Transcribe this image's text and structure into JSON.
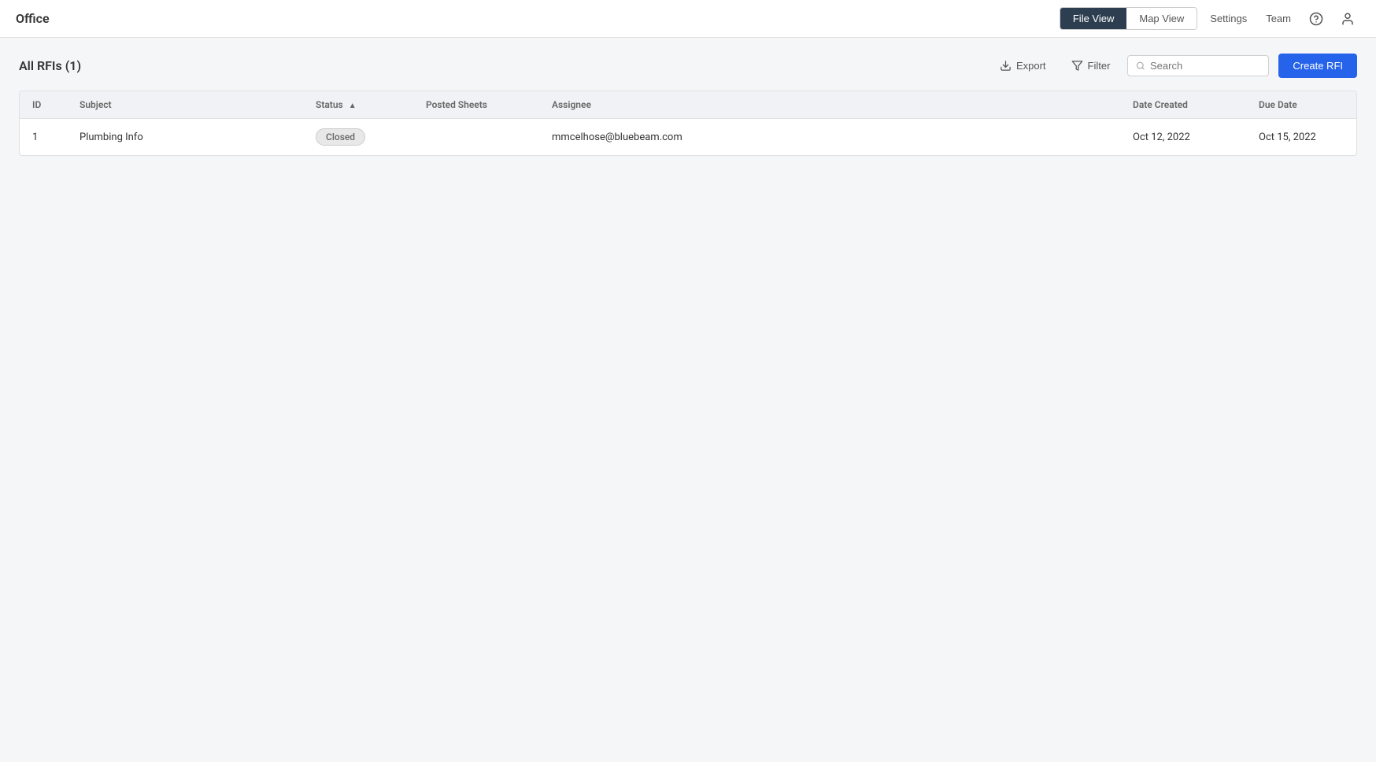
{
  "app": {
    "title": "Office"
  },
  "nav": {
    "file_view_label": "File View",
    "map_view_label": "Map View",
    "settings_label": "Settings",
    "team_label": "Team"
  },
  "page": {
    "title": "All RFIs (1)"
  },
  "toolbar": {
    "export_label": "Export",
    "filter_label": "Filter",
    "search_placeholder": "Search",
    "create_label": "Create RFI"
  },
  "table": {
    "columns": [
      {
        "key": "id",
        "label": "ID"
      },
      {
        "key": "subject",
        "label": "Subject"
      },
      {
        "key": "status",
        "label": "Status",
        "sortable": true
      },
      {
        "key": "posted_sheets",
        "label": "Posted Sheets"
      },
      {
        "key": "assignee",
        "label": "Assignee"
      },
      {
        "key": "date_created",
        "label": "Date Created"
      },
      {
        "key": "due_date",
        "label": "Due Date"
      }
    ],
    "rows": [
      {
        "id": "1",
        "subject": "Plumbing Info",
        "status": "Closed",
        "posted_sheets": "",
        "assignee": "mmcelhose@bluebeam.com",
        "date_created": "Oct 12, 2022",
        "due_date": "Oct 15, 2022"
      }
    ]
  }
}
